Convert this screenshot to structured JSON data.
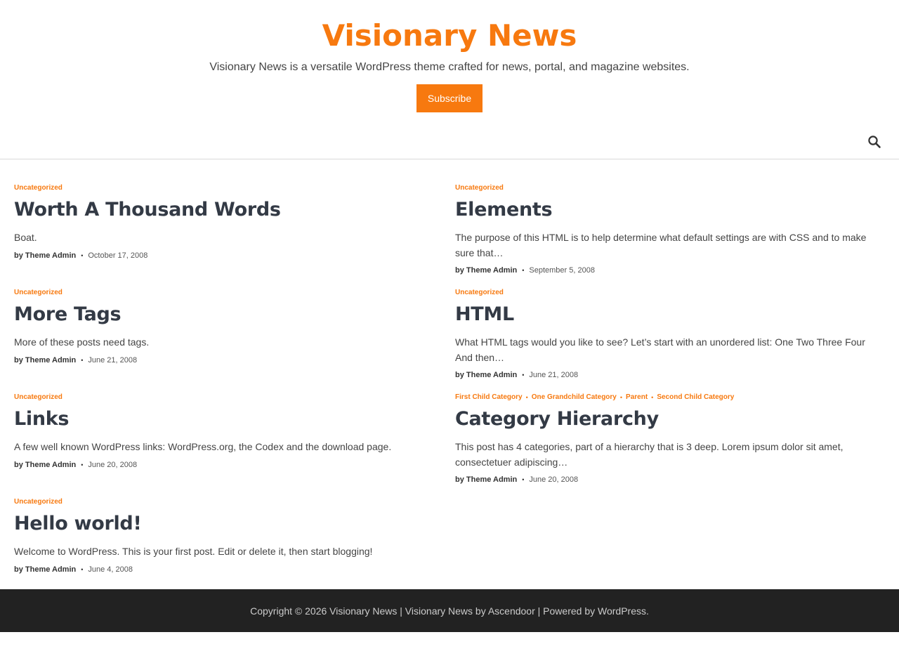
{
  "header": {
    "site_title": "Visionary News",
    "site_description": "Visionary News is a versatile WordPress theme crafted for news, portal, and magazine websites.",
    "subscribe_label": "Subscribe"
  },
  "posts": [
    {
      "categories": [
        "Uncategorized"
      ],
      "title": "Worth A Thousand Words",
      "excerpt": "Boat.",
      "author": "by Theme Admin",
      "date": "October 17, 2008"
    },
    {
      "categories": [
        "Uncategorized"
      ],
      "title": "Elements",
      "excerpt": "The purpose of this HTML is to help determine what default settings are with CSS and to make sure that…",
      "author": "by Theme Admin",
      "date": "September 5, 2008"
    },
    {
      "categories": [
        "Uncategorized"
      ],
      "title": "More Tags",
      "excerpt": "More of these posts need tags.",
      "author": "by Theme Admin",
      "date": "June 21, 2008"
    },
    {
      "categories": [
        "Uncategorized"
      ],
      "title": "HTML",
      "excerpt": "What HTML tags would you like to see? Let’s start with an unordered list: One Two Three Four And then…",
      "author": "by Theme Admin",
      "date": "June 21, 2008"
    },
    {
      "categories": [
        "Uncategorized"
      ],
      "title": "Links",
      "excerpt": "A few well known WordPress links: WordPress.org, the Codex and the download page.",
      "author": "by Theme Admin",
      "date": "June 20, 2008"
    },
    {
      "categories": [
        "First Child Category",
        "One Grandchild Category",
        "Parent",
        "Second Child Category"
      ],
      "title": "Category Hierarchy",
      "excerpt": "This post has 4 categories, part of a hierarchy that is 3 deep. Lorem ipsum dolor sit amet, consectetuer adipiscing…",
      "author": "by Theme Admin",
      "date": "June 20, 2008"
    },
    {
      "categories": [
        "Uncategorized"
      ],
      "title": "Hello world!",
      "excerpt": "Welcome to WordPress. This is your first post. Edit or delete it, then start blogging!",
      "author": "by Theme Admin",
      "date": "June 4, 2008"
    }
  ],
  "footer": {
    "copyright": "Copyright © 2026 Visionary News | Visionary News by Ascendoor | Powered by WordPress."
  },
  "colors": {
    "accent": "#f7790f",
    "footer_bg": "#222222",
    "title_text": "#333a45"
  },
  "icons": {
    "search": "search-icon"
  }
}
